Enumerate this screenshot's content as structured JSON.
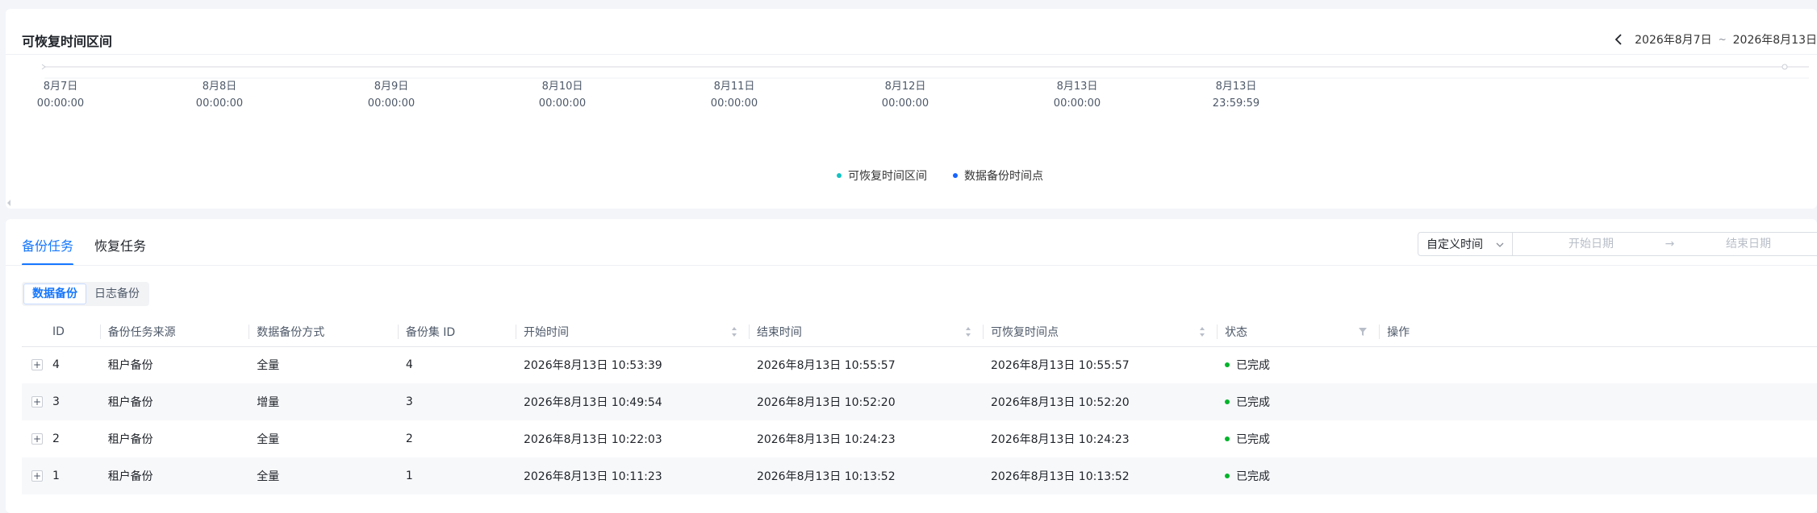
{
  "range_card": {
    "title": "可恢复时间区间",
    "nav": {
      "prev_icon": "chevron-left-icon",
      "start": "2026年8月7日",
      "separator": "~",
      "end": "2026年8月13日"
    },
    "ticks": [
      {
        "date": "8月7日",
        "time": "00:00:00"
      },
      {
        "date": "8月8日",
        "time": "00:00:00"
      },
      {
        "date": "8月9日",
        "time": "00:00:00"
      },
      {
        "date": "8月10日",
        "time": "00:00:00"
      },
      {
        "date": "8月11日",
        "time": "00:00:00"
      },
      {
        "date": "8月12日",
        "time": "00:00:00"
      },
      {
        "date": "8月13日",
        "time": "00:00:00"
      },
      {
        "date": "8月13日",
        "time": "23:59:59"
      }
    ],
    "legend": [
      {
        "label": "可恢复时间区间",
        "color": "#14c2c2"
      },
      {
        "label": "数据备份时间点",
        "color": "#1664ff"
      }
    ]
  },
  "task_card": {
    "tabs": [
      {
        "label": "备份任务",
        "active": true
      },
      {
        "label": "恢复任务",
        "active": false
      }
    ],
    "filter": {
      "select_value": "自定义时间",
      "start_placeholder": "开始日期",
      "end_placeholder": "结束日期",
      "arrow": "→"
    },
    "segments": [
      {
        "label": "数据备份",
        "active": true
      },
      {
        "label": "日志备份",
        "active": false
      }
    ],
    "columns": [
      "ID",
      "备份任务来源",
      "数据备份方式",
      "备份集 ID",
      "开始时间",
      "结束时间",
      "可恢复时间点",
      "状态",
      "操作"
    ],
    "rows": [
      {
        "id": "4",
        "source": "租户备份",
        "method": "全量",
        "set_id": "4",
        "start": "2026年8月13日 10:53:39",
        "end": "2026年8月13日 10:55:57",
        "recover": "2026年8月13日 10:55:57",
        "status": "已完成"
      },
      {
        "id": "3",
        "source": "租户备份",
        "method": "增量",
        "set_id": "3",
        "start": "2026年8月13日 10:49:54",
        "end": "2026年8月13日 10:52:20",
        "recover": "2026年8月13日 10:52:20",
        "status": "已完成"
      },
      {
        "id": "2",
        "source": "租户备份",
        "method": "全量",
        "set_id": "2",
        "start": "2026年8月13日 10:22:03",
        "end": "2026年8月13日 10:24:23",
        "recover": "2026年8月13日 10:24:23",
        "status": "已完成"
      },
      {
        "id": "1",
        "source": "租户备份",
        "method": "全量",
        "set_id": "1",
        "start": "2026年8月13日 10:11:23",
        "end": "2026年8月13日 10:13:52",
        "recover": "2026年8月13日 10:13:52",
        "status": "已完成"
      }
    ],
    "expand_symbol": "+",
    "status_color": "#00b42a"
  }
}
